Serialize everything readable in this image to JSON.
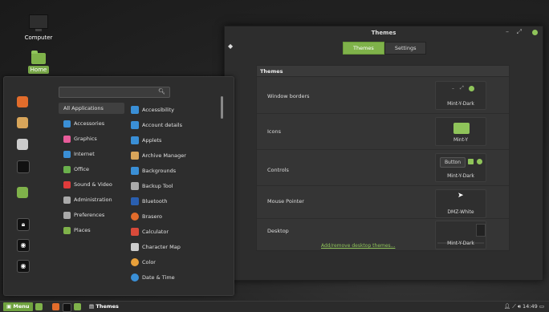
{
  "desktop": {
    "icons": [
      {
        "label": "Computer",
        "icon": "computer-icon"
      },
      {
        "label": "Home",
        "icon": "home-folder-icon"
      }
    ]
  },
  "menu": {
    "search": {
      "placeholder": "",
      "value": ""
    },
    "favorites": [
      {
        "icon": "ubuntu-icon",
        "color": "#e26c2b"
      },
      {
        "icon": "package-icon",
        "color": "#d8a55a"
      },
      {
        "icon": "settings-toggle-icon",
        "color": "#cccccc"
      },
      {
        "icon": "terminal-icon",
        "color": "#111111"
      },
      {
        "icon": "folder-icon",
        "color": "#7fb24a"
      },
      {
        "icon": "lock-icon",
        "color": "#111111"
      },
      {
        "icon": "logout-icon",
        "color": "#111111"
      },
      {
        "icon": "shutdown-icon",
        "color": "#111111"
      }
    ],
    "categories": [
      {
        "label": "All Applications",
        "color": ""
      },
      {
        "label": "Accessories",
        "color": "#3a8fd6"
      },
      {
        "label": "Graphics",
        "color": "#e85c9a"
      },
      {
        "label": "Internet",
        "color": "#3a8fd6"
      },
      {
        "label": "Office",
        "color": "#6ab04c"
      },
      {
        "label": "Sound & Video",
        "color": "#e03b3b"
      },
      {
        "label": "Administration",
        "color": "#aaaaaa"
      },
      {
        "label": "Preferences",
        "color": "#aaaaaa"
      },
      {
        "label": "Places",
        "color": "#7fb24a"
      }
    ],
    "apps": [
      {
        "label": "Accessibility",
        "color": "#3a8fd6"
      },
      {
        "label": "Account details",
        "color": "#3a8fd6"
      },
      {
        "label": "Applets",
        "color": "#3a8fd6"
      },
      {
        "label": "Archive Manager",
        "color": "#d8a55a"
      },
      {
        "label": "Backgrounds",
        "color": "#3a8fd6"
      },
      {
        "label": "Backup Tool",
        "color": "#aaaaaa"
      },
      {
        "label": "Bluetooth",
        "color": "#2a5fb0"
      },
      {
        "label": "Brasero",
        "color": "#e26c2b"
      },
      {
        "label": "Calculator",
        "color": "#d84a3a"
      },
      {
        "label": "Character Map",
        "color": "#cccccc"
      },
      {
        "label": "Color",
        "color": "#e8a03a"
      },
      {
        "label": "Date & Time",
        "color": "#3a8fd6"
      }
    ]
  },
  "window": {
    "title": "Themes",
    "tabs": [
      {
        "label": "Themes",
        "active": true
      },
      {
        "label": "Settings",
        "active": false
      }
    ],
    "panel_title": "Themes",
    "rows": [
      {
        "label": "Window borders",
        "value": "Mint-Y-Dark"
      },
      {
        "label": "Icons",
        "value": "Mint-Y"
      },
      {
        "label": "Controls",
        "value": "Mint-Y-Dark",
        "button_label": "Button"
      },
      {
        "label": "Mouse Pointer",
        "value": "DMZ-White"
      },
      {
        "label": "Desktop",
        "value": "Mint-Y-Dark"
      }
    ],
    "link": "Add/remove desktop themes...",
    "accent": "#7fb24a"
  },
  "taskbar": {
    "menu_label": "Menu",
    "window_label": "Themes",
    "clock": "14:49"
  }
}
